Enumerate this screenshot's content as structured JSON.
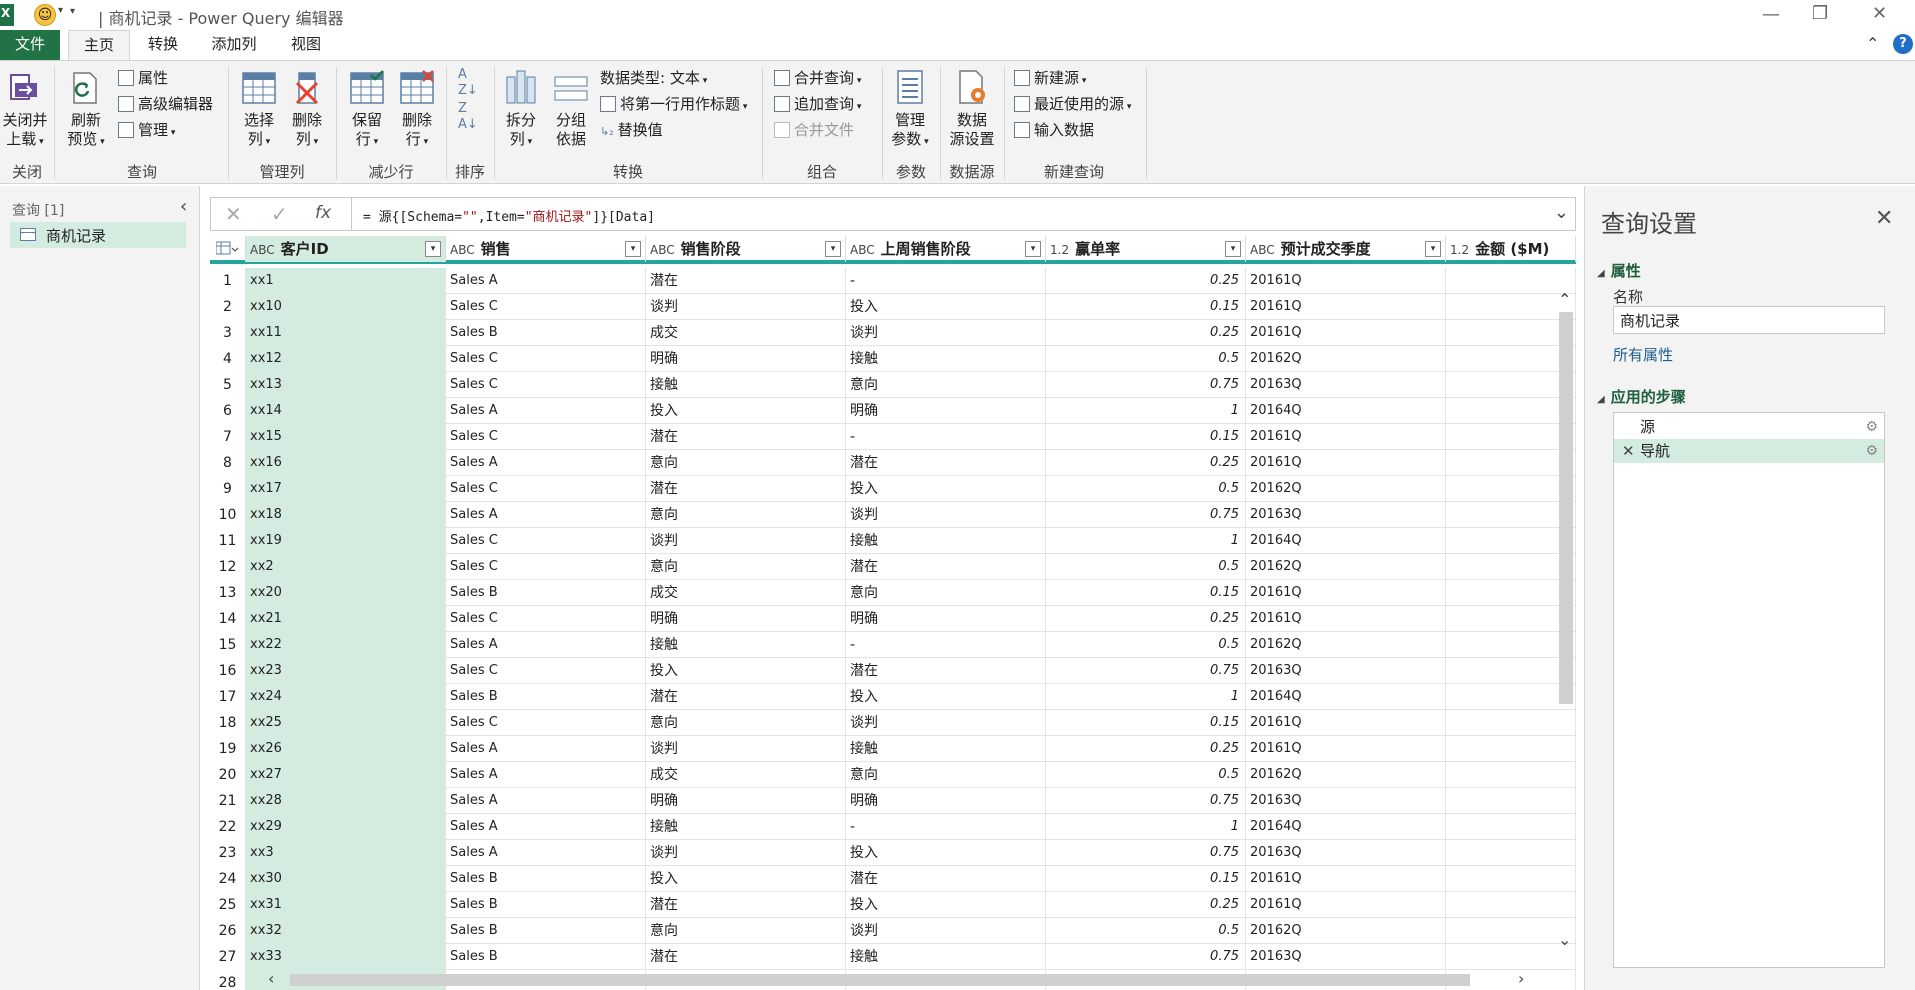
{
  "window": {
    "title": "| 商机记录 - Power Query 编辑器",
    "app_icon": "excel-icon",
    "min": "—",
    "restore": "❐",
    "close": "✕"
  },
  "tabs": [
    {
      "label": "文件"
    },
    {
      "label": "主页"
    },
    {
      "label": "转换"
    },
    {
      "label": "添加列"
    },
    {
      "label": "视图"
    }
  ],
  "ribbon": {
    "close_load": "关闭并\n上载",
    "refresh_preview": "刷新\n预览",
    "properties": "属性",
    "advanced_editor": "高级编辑器",
    "manage": "管理",
    "choose_columns": "选择\n列",
    "remove_columns": "删除\n列",
    "keep_rows": "保留\n行",
    "remove_rows": "删除\n行",
    "split_column": "拆分\n列",
    "group_by": "分组\n依据",
    "data_type": "数据类型: 文本",
    "first_row_headers": "将第一行用作标题",
    "replace_values": "替换值",
    "merge_queries": "合并查询",
    "append_queries": "追加查询",
    "combine_files": "合并文件",
    "manage_params": "管理\n参数",
    "data_source_settings": "数据\n源设置",
    "new_source": "新建源",
    "recent_sources": "最近使用的源",
    "enter_data": "输入数据",
    "groups": {
      "close": "关闭",
      "query": "查询",
      "manage_columns": "管理列",
      "reduce_rows": "减少行",
      "sort": "排序",
      "transform": "转换",
      "combine": "组合",
      "parameters": "参数",
      "data_sources": "数据源",
      "new_query": "新建查询"
    }
  },
  "queries_pane": {
    "header": "查询 [1]",
    "items": [
      {
        "label": "商机记录"
      }
    ]
  },
  "formula_bar": {
    "prefix": "= 源{[Schema=",
    "s1": "\"\"",
    "mid": ",Item=",
    "s2": "\"商机记录\"",
    "suffix": "]}[Data]"
  },
  "columns": [
    {
      "type": "ABC",
      "name": "客户ID"
    },
    {
      "type": "ABC",
      "name": "销售"
    },
    {
      "type": "ABC",
      "name": "销售阶段"
    },
    {
      "type": "ABC",
      "name": "上周销售阶段"
    },
    {
      "type": "1.2",
      "name": "赢单率"
    },
    {
      "type": "ABC",
      "name": "预计成交季度"
    },
    {
      "type": "1.2",
      "name": "金额 ($M)"
    }
  ],
  "rows": [
    [
      "1",
      "xx1",
      "Sales A",
      "潜在",
      "-",
      "0.25",
      "20161Q"
    ],
    [
      "2",
      "xx10",
      "Sales C",
      "谈判",
      "投入",
      "0.15",
      "20161Q"
    ],
    [
      "3",
      "xx11",
      "Sales B",
      "成交",
      "谈判",
      "0.25",
      "20161Q"
    ],
    [
      "4",
      "xx12",
      "Sales C",
      "明确",
      "接触",
      "0.5",
      "20162Q"
    ],
    [
      "5",
      "xx13",
      "Sales C",
      "接触",
      "意向",
      "0.75",
      "20163Q"
    ],
    [
      "6",
      "xx14",
      "Sales A",
      "投入",
      "明确",
      "1",
      "20164Q"
    ],
    [
      "7",
      "xx15",
      "Sales C",
      "潜在",
      "-",
      "0.15",
      "20161Q"
    ],
    [
      "8",
      "xx16",
      "Sales A",
      "意向",
      "潜在",
      "0.25",
      "20161Q"
    ],
    [
      "9",
      "xx17",
      "Sales C",
      "潜在",
      "投入",
      "0.5",
      "20162Q"
    ],
    [
      "10",
      "xx18",
      "Sales A",
      "意向",
      "谈判",
      "0.75",
      "20163Q"
    ],
    [
      "11",
      "xx19",
      "Sales C",
      "谈判",
      "接触",
      "1",
      "20164Q"
    ],
    [
      "12",
      "xx2",
      "Sales C",
      "意向",
      "潜在",
      "0.5",
      "20162Q"
    ],
    [
      "13",
      "xx20",
      "Sales B",
      "成交",
      "意向",
      "0.15",
      "20161Q"
    ],
    [
      "14",
      "xx21",
      "Sales C",
      "明确",
      "明确",
      "0.25",
      "20161Q"
    ],
    [
      "15",
      "xx22",
      "Sales A",
      "接触",
      "-",
      "0.5",
      "20162Q"
    ],
    [
      "16",
      "xx23",
      "Sales C",
      "投入",
      "潜在",
      "0.75",
      "20163Q"
    ],
    [
      "17",
      "xx24",
      "Sales B",
      "潜在",
      "投入",
      "1",
      "20164Q"
    ],
    [
      "18",
      "xx25",
      "Sales C",
      "意向",
      "谈判",
      "0.15",
      "20161Q"
    ],
    [
      "19",
      "xx26",
      "Sales A",
      "谈判",
      "接触",
      "0.25",
      "20161Q"
    ],
    [
      "20",
      "xx27",
      "Sales A",
      "成交",
      "意向",
      "0.5",
      "20162Q"
    ],
    [
      "21",
      "xx28",
      "Sales A",
      "明确",
      "明确",
      "0.75",
      "20163Q"
    ],
    [
      "22",
      "xx29",
      "Sales A",
      "接触",
      "-",
      "1",
      "20164Q"
    ],
    [
      "23",
      "xx3",
      "Sales A",
      "谈判",
      "投入",
      "0.75",
      "20163Q"
    ],
    [
      "24",
      "xx30",
      "Sales B",
      "投入",
      "潜在",
      "0.15",
      "20161Q"
    ],
    [
      "25",
      "xx31",
      "Sales B",
      "潜在",
      "投入",
      "0.25",
      "20161Q"
    ],
    [
      "26",
      "xx32",
      "Sales B",
      "意向",
      "谈判",
      "0.5",
      "20162Q"
    ],
    [
      "27",
      "xx33",
      "Sales B",
      "潜在",
      "接触",
      "0.75",
      "20163Q"
    ],
    [
      "28",
      "",
      "",
      "",
      "",
      "",
      ""
    ]
  ],
  "settings_pane": {
    "title": "查询设置",
    "properties_header": "属性",
    "name_label": "名称",
    "name_value": "商机记录",
    "all_properties": "所有属性",
    "steps_header": "应用的步骤",
    "steps": [
      {
        "label": "源",
        "active": false
      },
      {
        "label": "导航",
        "active": true
      }
    ]
  },
  "colors": {
    "file_tab": "#217346",
    "selected_column": "#d4ece0",
    "quality_bar": "#26a69a"
  }
}
